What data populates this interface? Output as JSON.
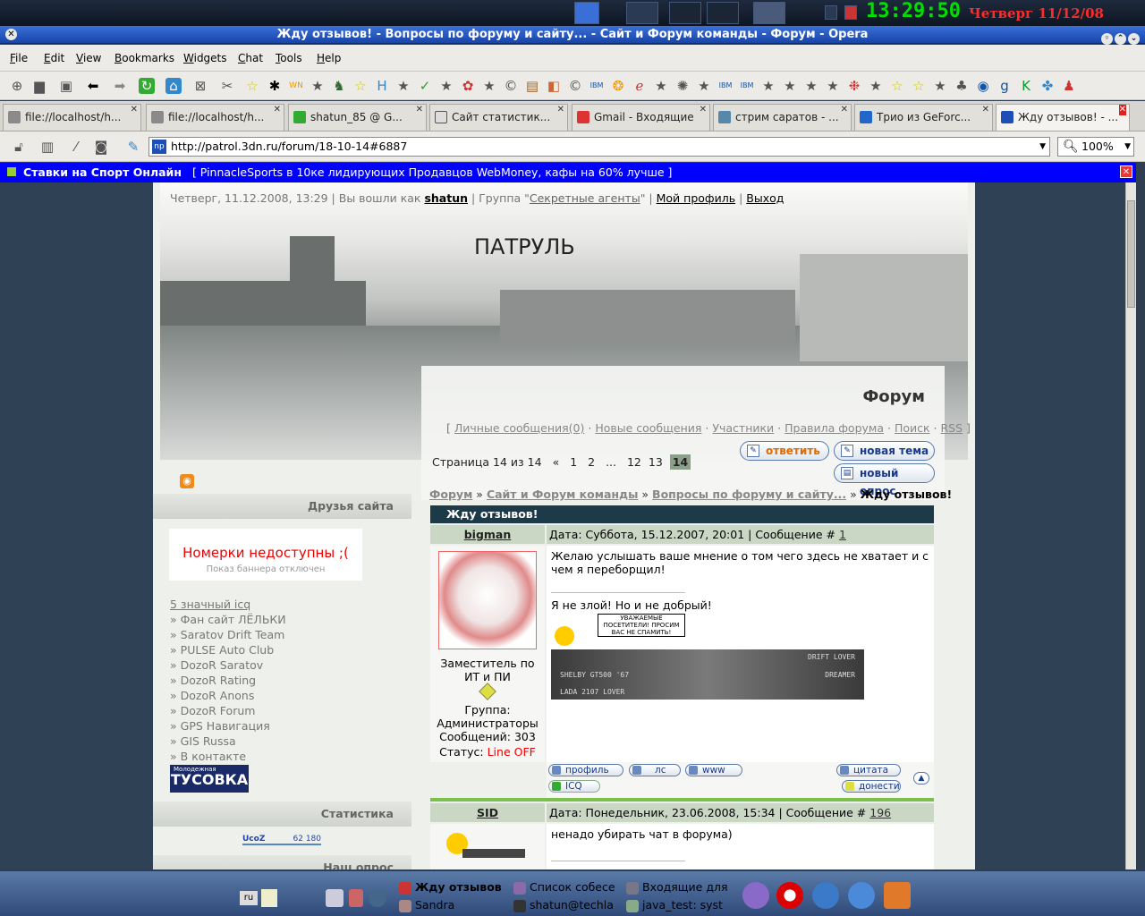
{
  "panel": {
    "clock": "13:29:50",
    "date": "Четверг 11/12/08"
  },
  "window": {
    "title": "Жду отзывов! - Вопросы по форуму и сайту... - Сайт и Форум команды - Форум - Opera"
  },
  "menu": [
    "File",
    "Edit",
    "View",
    "Bookmarks",
    "Widgets",
    "Chat",
    "Tools",
    "Help"
  ],
  "tabs": [
    {
      "label": "file://localhost/h..."
    },
    {
      "label": "file://localhost/h..."
    },
    {
      "label": "shatun_85 @ G..."
    },
    {
      "label": "Сайт статистик..."
    },
    {
      "label": "Gmail - Входящие"
    },
    {
      "label": "стрим саратов - ..."
    },
    {
      "label": "Трио из GeForc..."
    },
    {
      "label": "Жду отзывов! - ..."
    }
  ],
  "address": {
    "url": "http://patrol.3dn.ru/forum/18-10-14#6887",
    "url_icon": "np",
    "zoom": "100%"
  },
  "notice": {
    "link": "Ставки на Спорт Онлайн",
    "text": "[ PinnacleSports в 10ке лидирующих Продавцов WebMoney, кафы на 60% лучше ]"
  },
  "site": {
    "topline": {
      "prefix": "Четверг, 11.12.2008, 13:29 | Вы вошли как",
      "user": "shatun",
      "group_prefix": "| Группа \"",
      "group": "Секретные агенты",
      "group_suffix": "\" |",
      "profile": "Мой профиль",
      "sep": "|",
      "logout": "Выход"
    },
    "title": "ПАТРУЛЬ",
    "forum_title": "Форум",
    "forum_links": {
      "open": "[",
      "pm": "Личные сообщения(0)",
      "new": "Новые сообщения",
      "members": "Участники",
      "rules": "Правила форума",
      "search": "Поиск",
      "rss": "RSS",
      "close": "]",
      "dot": "·"
    },
    "pager": {
      "label": "Страница 14 из 14",
      "prev": "«",
      "pages": [
        "1",
        "2",
        "...",
        "12",
        "13"
      ],
      "current": "14"
    },
    "buttons": {
      "reply": "ответить",
      "new_topic": "новая тема",
      "new_poll": "новый опрос"
    },
    "breadcrumbs": {
      "forum": "Форум",
      "section": "Сайт и Форум команды",
      "subsection": "Вопросы по форуму и сайту...",
      "sep": "»",
      "current": "Жду отзывов!"
    },
    "thread_title": "Жду отзывов!"
  },
  "sidebar": {
    "friends_title": "Друзья сайта",
    "banner_main": "Номерки недоступны ;(",
    "banner_sub": "Показ баннера отключен",
    "links": [
      "5 значный icq",
      "Фан сайт ЛЁЛЬКИ",
      "Saratov Drift Team",
      "PULSE Auto Club",
      "DozoR Saratov",
      "DozoR Rating",
      "DozoR Anons",
      "DozoR Forum",
      "GPS Навигация",
      "GIS Russa",
      "В контакте"
    ],
    "tusovka_small": "Молодежная",
    "tusovka": "ТУСОВКА",
    "stats_title": "Статистика",
    "ucoz": "UcoZ",
    "ucoz_count": "62 180",
    "poll_title": "Наш опрос"
  },
  "posts": [
    {
      "author": "bigman",
      "meta_prefix": "Дата: Суббота, 15.12.2007, 20:01 | Сообщение #",
      "number": "1",
      "role": "Заместитель по ИТ и ПИ",
      "group": "Группа: Администраторы",
      "messages": "Сообщений: 303",
      "status_label": "Статус:",
      "status": "Line OFF",
      "text": "Желаю услышать ваше мнение о том чего здесь не хватает и с чем я переборщил!",
      "sig_text": "Я не злой! Но и не добрый!",
      "sig_badge": "УВАЖАЕМЫЕ ПОСЕТИТЕЛИ! ПРОСИМ ВАС НЕ СПАМИТЬ!",
      "sig_img_1": "DRIFT LOVER",
      "sig_img_2": "SHELBY GT500 '67",
      "sig_img_3": "DREAMER",
      "sig_img_4": "LADA 2107 LOVER",
      "actions": {
        "profile": "профиль",
        "pm": "лс",
        "www": "www",
        "icq": "ICQ",
        "quote": "цитата",
        "report": "донести"
      }
    },
    {
      "author": "SID",
      "meta_prefix": "Дата: Понедельник, 23.06.2008, 15:34 | Сообщение #",
      "number": "196",
      "text": "ненадо убирать чат в форума)"
    }
  ],
  "taskbar": {
    "items": [
      {
        "label": "Жду отзывов"
      },
      {
        "label": "Список собесе"
      },
      {
        "label": "Входящие для"
      },
      {
        "label": "Sandra"
      },
      {
        "label": "shatun@techla"
      },
      {
        "label": "java_test: syst"
      }
    ],
    "lang": "ru"
  },
  "colors": {
    "accent_blue": "#1845a8",
    "clock_green": "#00e000",
    "date_red": "#ff2a2a",
    "notice_blue": "#0000ff",
    "thread_head": "#1c3a48",
    "post_head": "#c9d7c4",
    "status_red": "#e00000"
  }
}
